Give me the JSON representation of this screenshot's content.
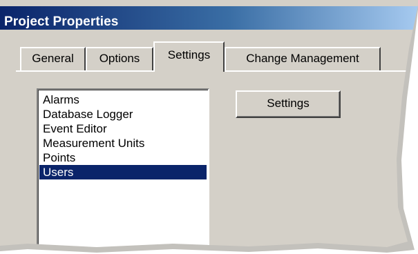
{
  "window": {
    "title": "Project Properties"
  },
  "tabs": [
    {
      "label": "General",
      "active": false
    },
    {
      "label": "Options",
      "active": false
    },
    {
      "label": "Settings",
      "active": true
    },
    {
      "label": "Change Management",
      "active": false
    }
  ],
  "settings_page": {
    "list_items": [
      {
        "label": "Alarms",
        "selected": false
      },
      {
        "label": "Database Logger",
        "selected": false
      },
      {
        "label": "Event Editor",
        "selected": false
      },
      {
        "label": "Measurement Units",
        "selected": false
      },
      {
        "label": "Points",
        "selected": false
      },
      {
        "label": "Users",
        "selected": true
      }
    ],
    "settings_button_label": "Settings"
  },
  "colors": {
    "dialog_face": "#d4d0c8",
    "title_gradient_start": "#0a246a",
    "title_gradient_end": "#a6caf0",
    "selection": "#0a246a"
  }
}
